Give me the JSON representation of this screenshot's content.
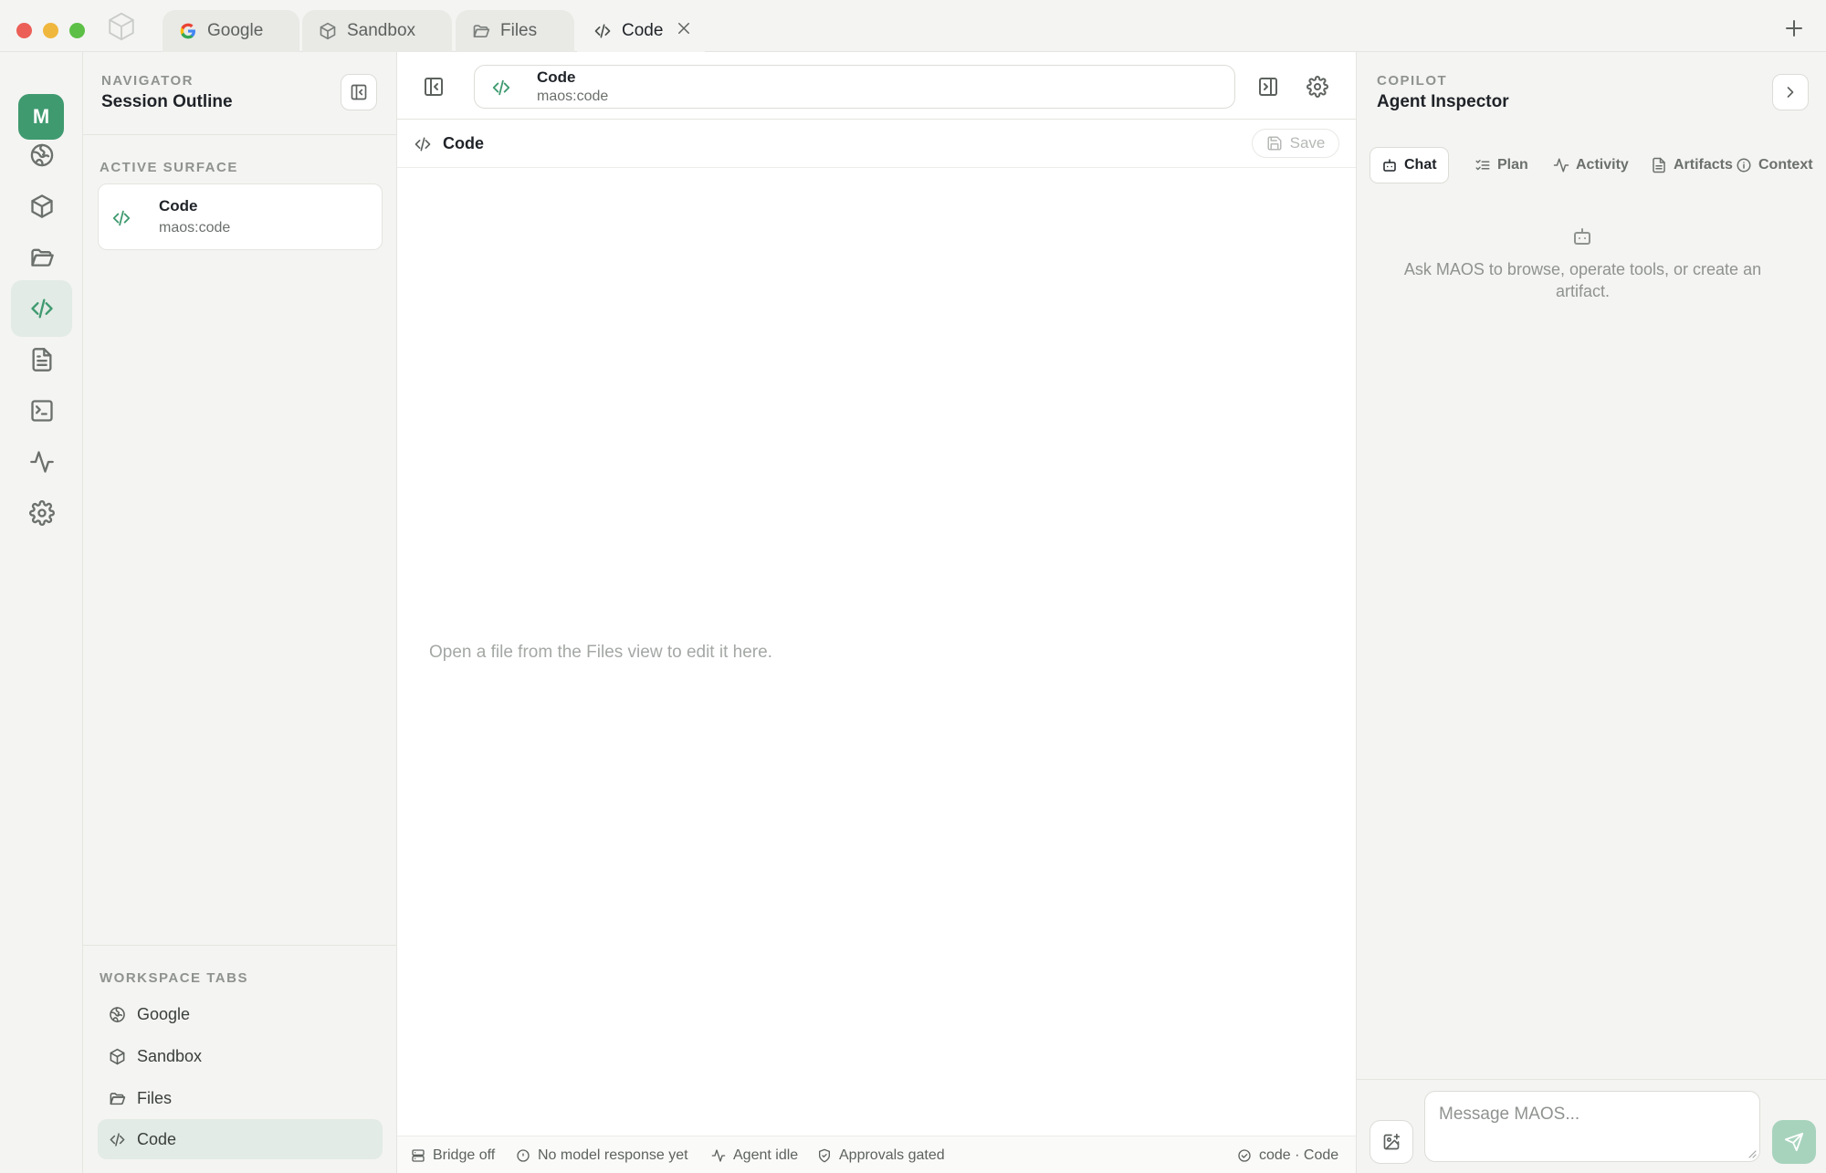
{
  "tabs": [
    {
      "label": "Google",
      "icon": "google-icon"
    },
    {
      "label": "Sandbox",
      "icon": "cube-icon"
    },
    {
      "label": "Files",
      "icon": "folder-icon"
    },
    {
      "label": "Code",
      "icon": "code-icon",
      "active": true
    }
  ],
  "rail": {
    "avatar": "M",
    "items": [
      "globe-icon",
      "cube-icon",
      "folder-icon",
      "code-icon",
      "document-icon",
      "terminal-icon",
      "activity-icon",
      "gear-icon"
    ],
    "active_item": "code-icon"
  },
  "navigator": {
    "eyebrow": "NAVIGATOR",
    "title": "Session Outline",
    "active_surface_label": "ACTIVE SURFACE",
    "surface": {
      "title": "Code",
      "subtitle": "maos:code"
    },
    "workspace_tabs_label": "WORKSPACE TABS",
    "workspace_tabs": [
      {
        "label": "Google",
        "icon": "globe-icon"
      },
      {
        "label": "Sandbox",
        "icon": "cube-icon"
      },
      {
        "label": "Files",
        "icon": "folder-icon"
      },
      {
        "label": "Code",
        "icon": "code-icon",
        "active": true
      }
    ]
  },
  "center": {
    "address": {
      "title": "Code",
      "subtitle": "maos:code"
    },
    "editor_title": "Code",
    "save_label": "Save",
    "empty_message": "Open a file from the Files view to edit it here.",
    "status": {
      "bridge": "Bridge off",
      "model": "No model response yet",
      "agent": "Agent idle",
      "approvals": "Approvals gated",
      "right": "code · Code"
    }
  },
  "copilot": {
    "eyebrow": "COPILOT",
    "title": "Agent Inspector",
    "tabs": [
      {
        "label": "Chat",
        "active": true
      },
      {
        "label": "Plan"
      },
      {
        "label": "Activity"
      },
      {
        "label": "Artifacts"
      },
      {
        "label": "Context"
      }
    ],
    "empty_message": "Ask MAOS to browse, operate tools, or create an artifact.",
    "input_placeholder": "Message MAOS..."
  },
  "colors": {
    "accent": "#3f9a70",
    "accent_soft": "#e2ebe5",
    "close": "#ec5f57",
    "minimize": "#f0b73e",
    "maximize": "#5cc046"
  }
}
